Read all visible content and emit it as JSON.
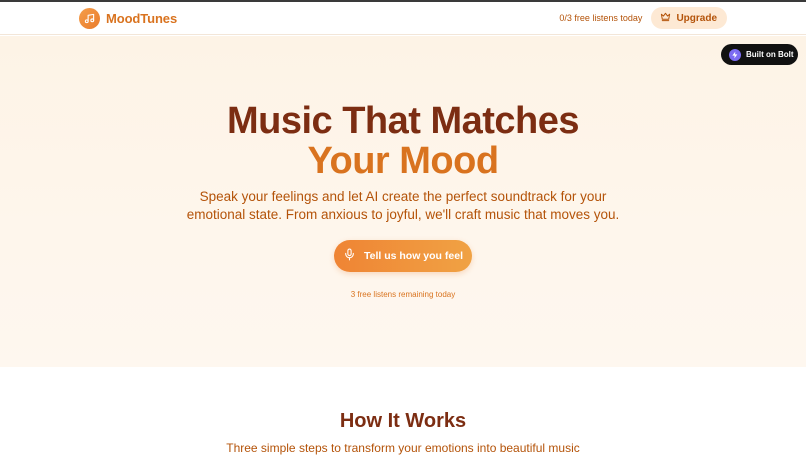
{
  "header": {
    "brand_name": "MoodTunes",
    "logo_icon": "music-note-icon",
    "listens_text": "0/3 free listens today",
    "upgrade_label": "Upgrade",
    "upgrade_icon": "crown-icon"
  },
  "hero": {
    "headline_line1": "Music That Matches",
    "headline_line2": "Your Mood",
    "subtitle_line1": "Speak your feelings and let AI create the perfect soundtrack for your",
    "subtitle_line2": "emotional state. From anxious to joyful, we'll craft music that moves you.",
    "cta_label": "Tell us how you feel",
    "cta_icon": "microphone-icon",
    "remaining_text": "3 free listens remaining today"
  },
  "badge": {
    "label": "Built on Bolt",
    "icon": "bolt-icon"
  },
  "how_it_works": {
    "title": "How It Works",
    "subtitle": "Three simple steps to transform your emotions into beautiful music"
  },
  "colors": {
    "brand_orange": "#d9731f",
    "dark_brown": "#7c2d12",
    "accent_text": "#b45309",
    "hero_bg": "#fdf3e6",
    "upgrade_bg": "#fde9d4",
    "badge_bg": "#111111"
  }
}
